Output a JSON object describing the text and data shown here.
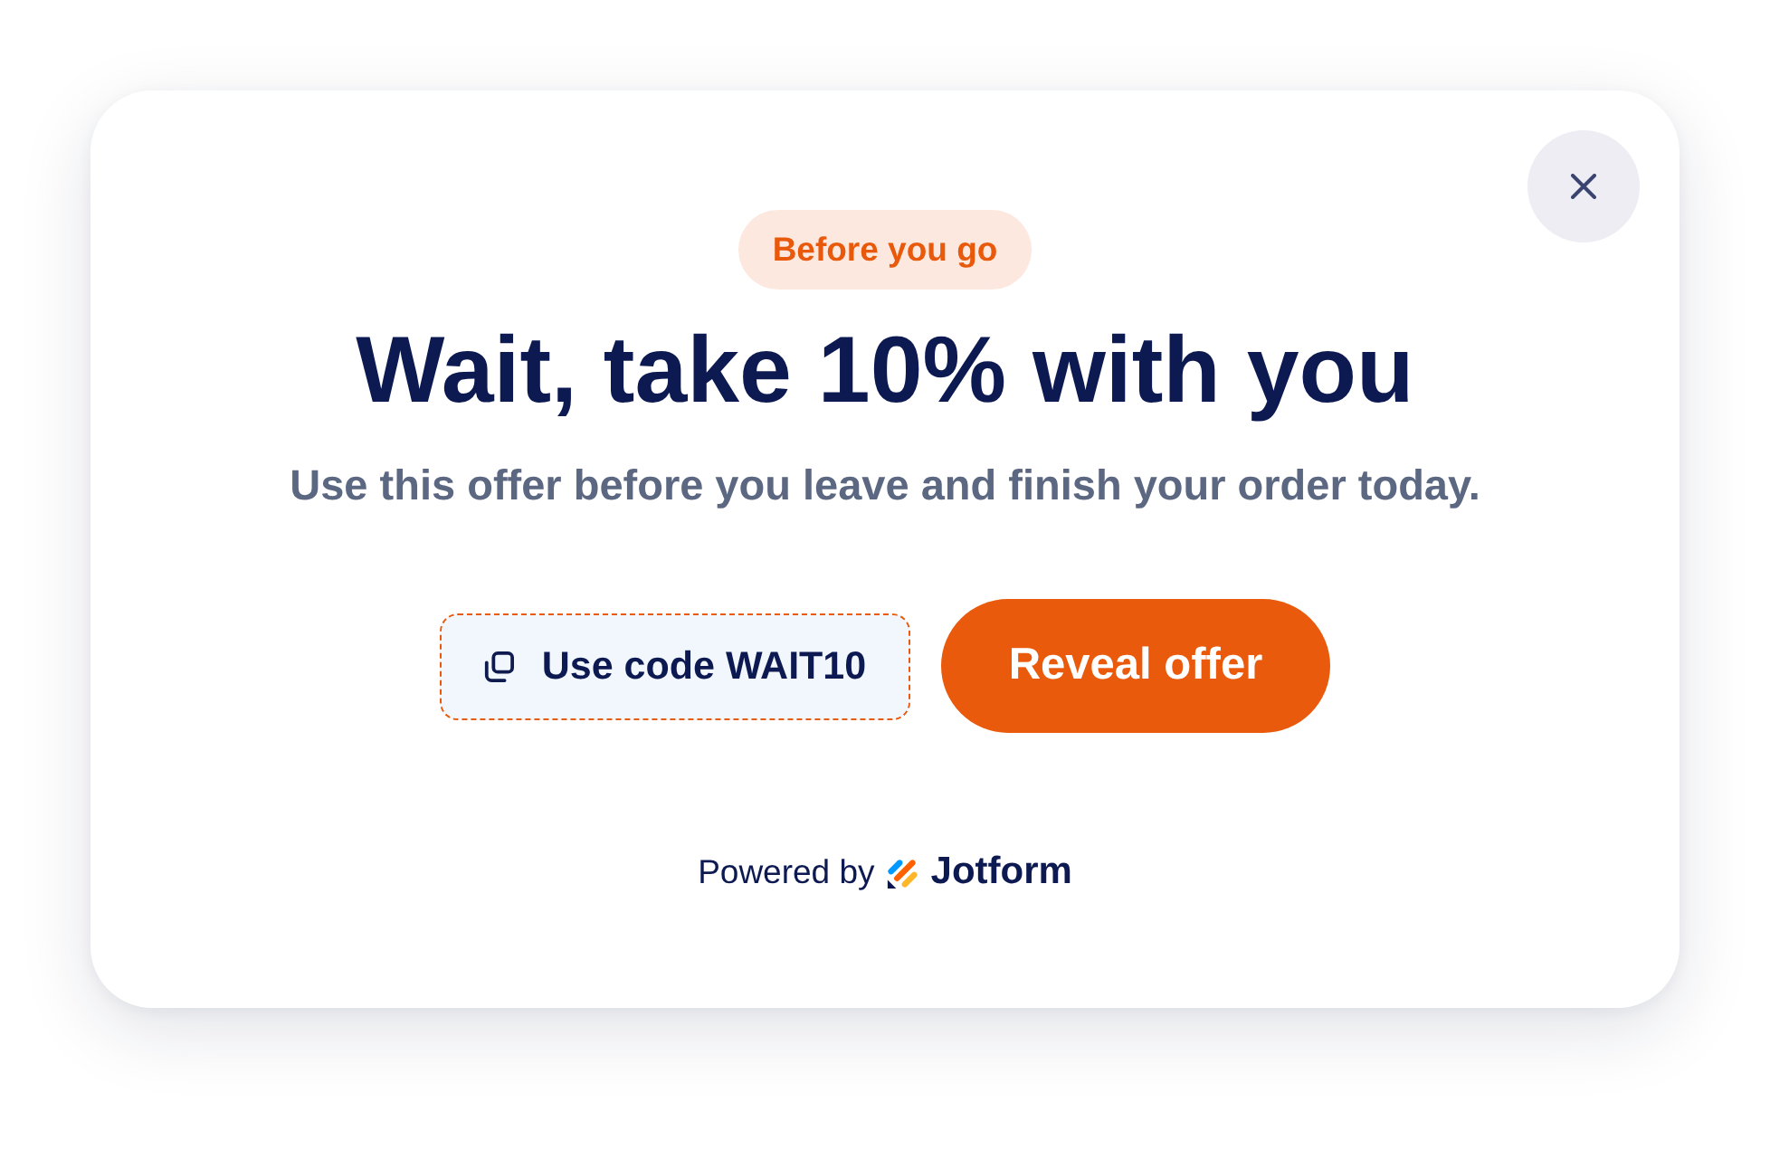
{
  "dialog": {
    "badge": "Before you go",
    "title": "Wait, take 10% with you",
    "subtitle": "Use this offer before you leave and finish your order today.",
    "actions": [
      {
        "kind": "code",
        "label": "Use code WAIT10"
      },
      {
        "kind": "primary",
        "label": "Reveal offer"
      }
    ],
    "footer": {
      "prefix": "Powered by",
      "brand": "Jotform"
    }
  }
}
